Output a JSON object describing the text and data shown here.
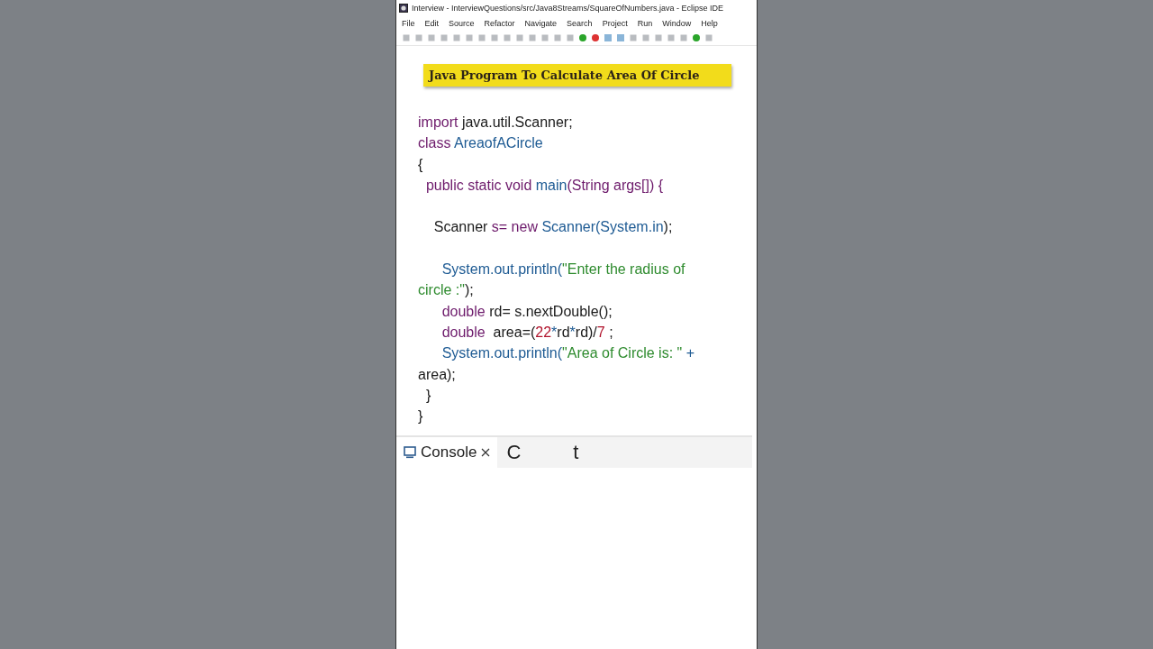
{
  "window": {
    "title": "Interview - InterviewQuestions/src/Java8Streams/SquareOfNumbers.java - Eclipse IDE"
  },
  "menu": [
    "File",
    "Edit",
    "Source",
    "Refactor",
    "Navigate",
    "Search",
    "Project",
    "Run",
    "Window",
    "Help"
  ],
  "banner": "Java Program To Calculate Area Of Circle",
  "code_lines": [
    {
      "kind": "code",
      "tokens": [
        {
          "kind": "kw",
          "text": "import"
        },
        {
          "kind": "plain",
          "text": " java.util.Scanner;"
        }
      ]
    },
    {
      "kind": "code",
      "tokens": [
        {
          "kind": "kw",
          "text": "class"
        },
        {
          "kind": "type",
          "text": " AreaofACircle"
        }
      ]
    },
    {
      "kind": "code",
      "tokens": [
        {
          "kind": "plain",
          "text": "{"
        }
      ]
    },
    {
      "kind": "code",
      "tokens": [
        {
          "kind": "kw",
          "text": "  public static void"
        },
        {
          "kind": "type",
          "text": " main"
        },
        {
          "kind": "kw",
          "text": "(String args[]) {"
        }
      ]
    },
    {
      "kind": "blank"
    },
    {
      "kind": "code",
      "tokens": [
        {
          "kind": "plain",
          "text": "    Scanner"
        },
        {
          "kind": "kw",
          "text": " s= new"
        },
        {
          "kind": "type",
          "text": " Scanner(System.in"
        },
        {
          "kind": "plain",
          "text": ");"
        }
      ]
    },
    {
      "kind": "blank"
    },
    {
      "kind": "code",
      "tokens": [
        {
          "kind": "type",
          "text": "      System.out.println("
        },
        {
          "kind": "str",
          "text": "\"Enter the radius of"
        }
      ]
    },
    {
      "kind": "code",
      "tokens": [
        {
          "kind": "str",
          "text": "circle :\""
        },
        {
          "kind": "plain",
          "text": ");"
        }
      ]
    },
    {
      "kind": "code",
      "tokens": [
        {
          "kind": "kw",
          "text": "      double"
        },
        {
          "kind": "plain",
          "text": " rd= s.nextDouble();"
        }
      ]
    },
    {
      "kind": "code",
      "tokens": [
        {
          "kind": "kw",
          "text": "      double"
        },
        {
          "kind": "plain",
          "text": "  area=("
        },
        {
          "kind": "num",
          "text": "22"
        },
        {
          "kind": "type",
          "text": "*"
        },
        {
          "kind": "plain",
          "text": "rd"
        },
        {
          "kind": "type",
          "text": "*"
        },
        {
          "kind": "plain",
          "text": "rd)/"
        },
        {
          "kind": "num",
          "text": "7"
        },
        {
          "kind": "plain",
          "text": " ;"
        }
      ]
    },
    {
      "kind": "code",
      "tokens": [
        {
          "kind": "type",
          "text": "      System.out.println("
        },
        {
          "kind": "str",
          "text": "\"Area of Circle is: \""
        },
        {
          "kind": "type",
          "text": " +"
        }
      ]
    },
    {
      "kind": "code",
      "tokens": [
        {
          "kind": "plain",
          "text": "area);"
        }
      ]
    },
    {
      "kind": "code",
      "tokens": [
        {
          "kind": "plain",
          "text": "  }"
        }
      ]
    },
    {
      "kind": "code",
      "tokens": [
        {
          "kind": "plain",
          "text": "}"
        }
      ]
    }
  ],
  "console_tabs": [
    {
      "label": "Console",
      "selected": true
    },
    {
      "label": "C",
      "selected": false
    }
  ],
  "console_fragment": "t"
}
